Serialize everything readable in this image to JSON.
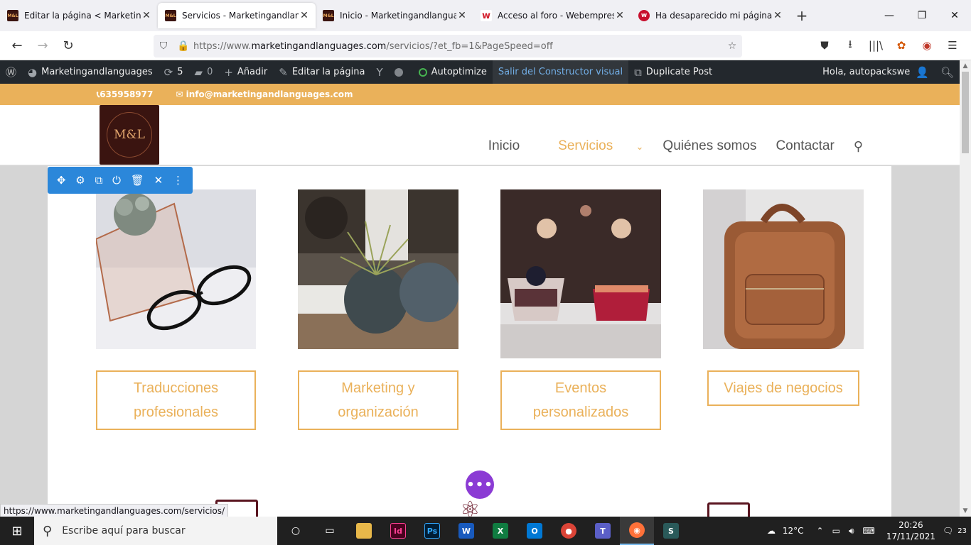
{
  "browser": {
    "tabs": [
      {
        "title": "Editar la página < Marketingandlanguages",
        "favicon": "ml",
        "active": false
      },
      {
        "title": "Servicios - Marketingandlanguages",
        "favicon": "ml",
        "active": true
      },
      {
        "title": "Inicio - Marketingandlanguages",
        "favicon": "ml",
        "active": false
      },
      {
        "title": "Acceso al foro - Webempresa Europa",
        "favicon": "we",
        "active": false
      },
      {
        "title": "Ha desaparecido mi página de servicios",
        "favicon": "wred",
        "active": false
      }
    ],
    "new_tab": "+",
    "url_prefix": "https://www.",
    "url_domain": "marketingandlanguages.com",
    "url_path": "/servicios/?et_fb=1&PageSpeed=off",
    "status_url": "https://www.marketingandlanguages.com/servicios/"
  },
  "wp_admin_bar": {
    "site_name": "Marketingandlanguages",
    "updates_count": "5",
    "comments_count": "0",
    "add_new": "Añadir",
    "edit_page": "Editar la página",
    "autoptimize": "Autoptimize",
    "exit_builder": "Salir del Constructor visual",
    "duplicate_post": "Duplicate Post",
    "greeting": "Hola, autopackswe"
  },
  "site": {
    "phone": "635958977",
    "email": "info@marketingandlanguages.com",
    "logo_text": "M&L",
    "menu": [
      {
        "label": "Inicio",
        "active": false
      },
      {
        "label": "Servicios",
        "active": true
      },
      {
        "label": "Quiénes somos",
        "active": false
      },
      {
        "label": "Contactar",
        "active": false
      }
    ],
    "services": [
      {
        "line1": "Traducciones",
        "line2": "profesionales"
      },
      {
        "line1": "Marketing y",
        "line2": "organización"
      },
      {
        "line1": "Eventos",
        "line2": "personalizados"
      },
      {
        "line1": "Viajes de negocios",
        "line2": ""
      }
    ],
    "accent_color": "#eab15a"
  },
  "taskbar": {
    "search_placeholder": "Escribe aquí para buscar",
    "weather": "12°C",
    "time": "20:26",
    "date": "17/11/2021",
    "notifications": "23"
  }
}
